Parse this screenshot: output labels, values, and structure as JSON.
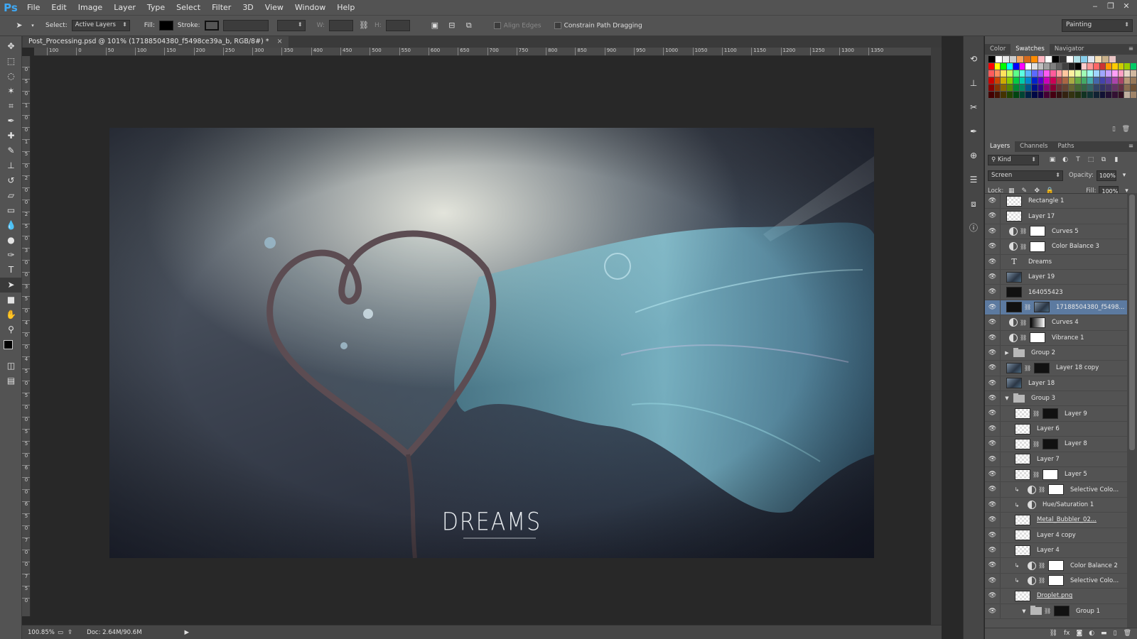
{
  "app": {
    "logo": "Ps"
  },
  "menu": [
    "File",
    "Edit",
    "Image",
    "Layer",
    "Type",
    "Select",
    "Filter",
    "3D",
    "View",
    "Window",
    "Help"
  ],
  "window_controls": [
    "‒",
    "❐",
    "✕"
  ],
  "options": {
    "select_label": "Select:",
    "select_value": "Active Layers",
    "fill_label": "Fill:",
    "stroke_label": "Stroke:",
    "w_label": "W:",
    "h_label": "H:",
    "align_edges": "Align Edges",
    "constrain": "Constrain Path Dragging",
    "workspace": "Painting"
  },
  "document": {
    "tab_title": "Post_Processing.psd @ 101% (17188504380_f5498ce39a_b, RGB/8#) *",
    "close": "×",
    "canvas_text": "DREAMS",
    "zoom": "100.85%",
    "doc_size": "Doc: 2.64M/90.6M"
  },
  "ruler_top": [
    "100",
    "0",
    "50",
    "100",
    "150",
    "200",
    "250",
    "300",
    "350",
    "400",
    "450",
    "500",
    "550",
    "600",
    "650",
    "700",
    "750",
    "800",
    "850",
    "900",
    "950",
    "1000",
    "1050",
    "1100",
    "1150",
    "1200",
    "1250",
    "1300",
    "1350"
  ],
  "ruler_left": [
    "0",
    "5",
    "0",
    "1",
    "0",
    "0",
    "1",
    "5",
    "0",
    "2",
    "0",
    "0",
    "2",
    "5",
    "0",
    "3",
    "0",
    "0",
    "3",
    "5",
    "0",
    "4",
    "0",
    "0",
    "4",
    "5",
    "0",
    "5",
    "0",
    "0",
    "5",
    "5",
    "0",
    "6",
    "0",
    "0",
    "6",
    "5",
    "0",
    "7",
    "0",
    "0",
    "7",
    "5",
    "0"
  ],
  "top_panel": {
    "tabs": [
      "Color",
      "Swatches",
      "Navigator"
    ],
    "active": "Swatches",
    "swatch_rows": [
      [
        "#000000",
        "#ffffff",
        "#e6e6e6",
        "#cccccc",
        "#f4a460",
        "#d2691e",
        "#ff8c00",
        "#ffb6c1",
        "#ffffff",
        "#000000",
        "#333333",
        "#ffffff",
        "#b0e0e6",
        "#87ceeb",
        "#dfe7f3",
        "#f5deb3",
        "#c8b08a",
        "#e9c4c4"
      ],
      [
        "#ff0000",
        "#ffff00",
        "#00ff00",
        "#00ffff",
        "#0000ff",
        "#ff00ff",
        "#ffffff",
        "#e0e0e0",
        "#c0c0c0",
        "#a0a0a0",
        "#808080",
        "#606060",
        "#404040",
        "#202020",
        "#000000",
        "#ffcccc",
        "#ff9999",
        "#ff6666",
        "#cc3333",
        "#ff9900",
        "#ffcc00",
        "#cccc00",
        "#99cc00",
        "#00cc66"
      ],
      [
        "#ff5c5c",
        "#ff8d5c",
        "#ffe15c",
        "#c6ff5c",
        "#5cff8a",
        "#5cffe2",
        "#5cb6ff",
        "#5c6aff",
        "#9d5cff",
        "#ff5cf1",
        "#ff5c9a",
        "#ff9f9f",
        "#ffc69f",
        "#fff09f",
        "#dcff9f",
        "#9fffb5",
        "#9ffff0",
        "#9fd4ff",
        "#9fa6ff",
        "#c89fff",
        "#ff9ff7",
        "#ff9fc3",
        "#e8d8c8",
        "#d0b89f"
      ],
      [
        "#cc0000",
        "#cc4400",
        "#ccaa00",
        "#88cc00",
        "#00cc44",
        "#00ccaa",
        "#0088cc",
        "#0022cc",
        "#5500cc",
        "#cc00bb",
        "#cc0055",
        "#aa4444",
        "#aa6644",
        "#aaaa44",
        "#66aa44",
        "#44aa66",
        "#44aaaa",
        "#4466aa",
        "#4444aa",
        "#6644aa",
        "#aa44aa",
        "#aa4466",
        "#b89878",
        "#987858"
      ],
      [
        "#880000",
        "#883300",
        "#886600",
        "#558800",
        "#008833",
        "#008866",
        "#005588",
        "#001188",
        "#330088",
        "#880077",
        "#880033",
        "#663333",
        "#664433",
        "#666633",
        "#446633",
        "#336644",
        "#336666",
        "#334466",
        "#333366",
        "#443366",
        "#663366",
        "#663344",
        "#8a6e50",
        "#6e5034"
      ],
      [
        "#440000",
        "#441100",
        "#443300",
        "#224400",
        "#004411",
        "#004433",
        "#002244",
        "#000844",
        "#110044",
        "#440033",
        "#440011",
        "#331111",
        "#332211",
        "#333311",
        "#223311",
        "#113322",
        "#113333",
        "#112233",
        "#111133",
        "#221133",
        "#331133",
        "#331122",
        "#bfae9e",
        "#a08468"
      ]
    ]
  },
  "layers_panel": {
    "tabs": [
      "Layers",
      "Channels",
      "Paths"
    ],
    "active": "Layers",
    "filter": "Kind",
    "blend_mode": "Screen",
    "opacity_label": "Opacity:",
    "opacity": "100%",
    "lock_label": "Lock:",
    "fill_label": "Fill:",
    "fill": "100%",
    "layers": [
      {
        "name": "Rectangle 1",
        "kind": "check",
        "indent": 0
      },
      {
        "name": "Layer 17",
        "kind": "check",
        "indent": 0
      },
      {
        "name": "Curves 5",
        "kind": "adj",
        "mask": "white",
        "indent": 0
      },
      {
        "name": "Color Balance 3",
        "kind": "adj",
        "mask": "white",
        "indent": 0
      },
      {
        "name": "Dreams",
        "kind": "type",
        "indent": 0
      },
      {
        "name": "Layer 19",
        "kind": "photo",
        "indent": 0
      },
      {
        "name": "164055423",
        "kind": "black",
        "indent": 0
      },
      {
        "name": "17188504380_f5498...",
        "kind": "black",
        "mask": "photo",
        "indent": 0,
        "selected": true
      },
      {
        "name": "Curves 4",
        "kind": "adj",
        "mask": "grad",
        "indent": 0
      },
      {
        "name": "Vibrance 1",
        "kind": "adj",
        "mask": "white",
        "indent": 0
      },
      {
        "name": "Group 2",
        "kind": "folder",
        "indent": 0,
        "arrow": "▶"
      },
      {
        "name": "Layer 18 copy",
        "kind": "photo",
        "mask": "black",
        "indent": 0
      },
      {
        "name": "Layer 18",
        "kind": "photo",
        "indent": 0
      },
      {
        "name": "Group 3",
        "kind": "folder",
        "indent": 0,
        "arrow": "▼"
      },
      {
        "name": "Layer 9",
        "kind": "check",
        "mask": "black",
        "indent": 1
      },
      {
        "name": "Layer 6",
        "kind": "check",
        "indent": 1
      },
      {
        "name": "Layer 8",
        "kind": "check",
        "mask": "black",
        "indent": 1
      },
      {
        "name": "Layer 7",
        "kind": "check",
        "indent": 1
      },
      {
        "name": "Layer 5",
        "kind": "check",
        "mask": "white",
        "indent": 1
      },
      {
        "name": "Selective Colo...",
        "kind": "adj",
        "mask": "white",
        "indent": 1,
        "clip": true
      },
      {
        "name": "Hue/Saturation 1",
        "kind": "adj",
        "indent": 1,
        "clip": true
      },
      {
        "name": "Metal_Bubbler_02...",
        "kind": "check",
        "indent": 1,
        "underline": true
      },
      {
        "name": "Layer 4 copy",
        "kind": "check",
        "indent": 1
      },
      {
        "name": "Layer 4",
        "kind": "check",
        "indent": 1
      },
      {
        "name": "Color Balance 2",
        "kind": "adj",
        "mask": "white",
        "indent": 1,
        "clip": true
      },
      {
        "name": "Selective Colo...",
        "kind": "adj",
        "mask": "white",
        "indent": 1,
        "clip": true
      },
      {
        "name": "Droplet.png",
        "kind": "check",
        "indent": 1,
        "underline": true
      },
      {
        "name": "Group 1",
        "kind": "folder",
        "mask": "black",
        "indent": 2,
        "arrow": "▼"
      }
    ]
  }
}
